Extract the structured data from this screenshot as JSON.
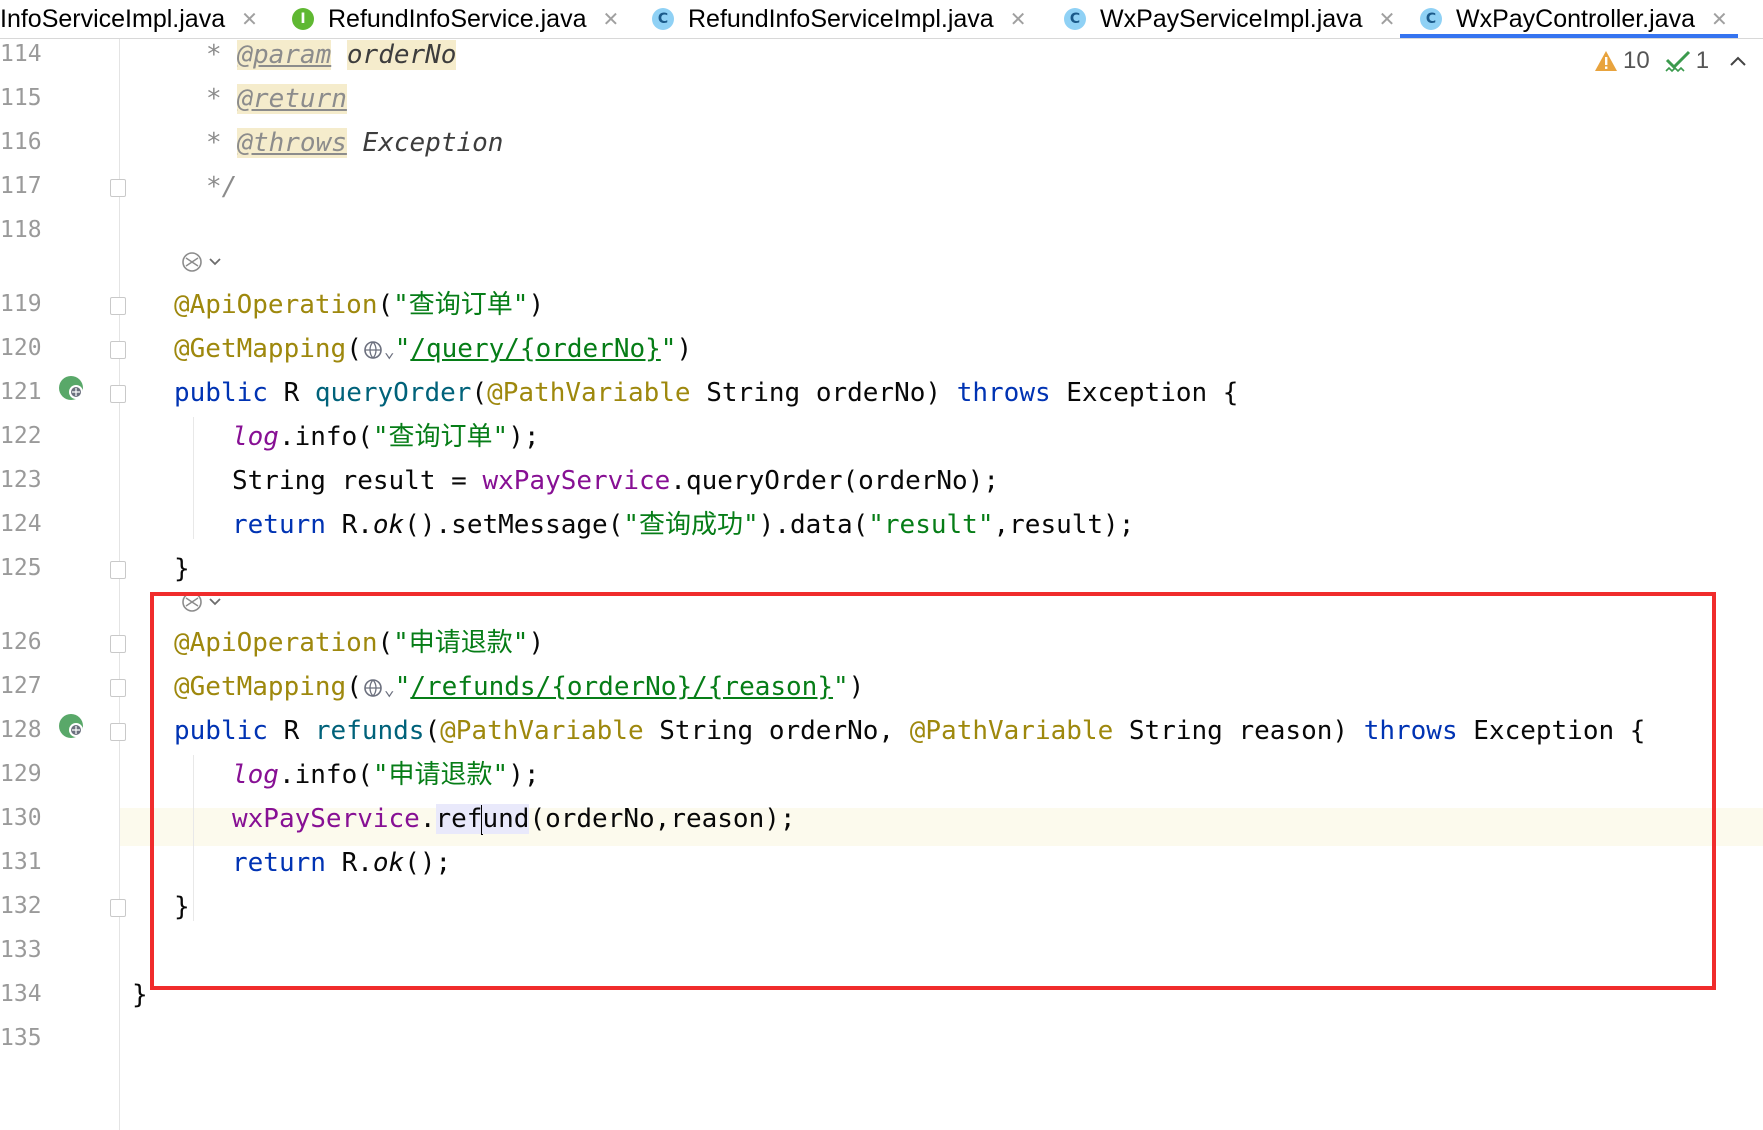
{
  "tabs": [
    {
      "label": "InfoServiceImpl.java",
      "icon": "",
      "active": false
    },
    {
      "label": "RefundInfoService.java",
      "icon": "I",
      "active": false
    },
    {
      "label": "RefundInfoServiceImpl.java",
      "icon": "C",
      "active": false
    },
    {
      "label": "WxPayServiceImpl.java",
      "icon": "C",
      "active": false
    },
    {
      "label": "WxPayController.java",
      "icon": "C",
      "active": true
    }
  ],
  "close_glyph": "✕",
  "inspections": {
    "warnings": "10",
    "checks": "1"
  },
  "line_numbers": [
    "114",
    "115",
    "116",
    "117",
    "118",
    "119",
    "120",
    "121",
    "122",
    "123",
    "124",
    "125",
    "126",
    "127",
    "128",
    "129",
    "130",
    "131",
    "132",
    "133",
    "134",
    "135"
  ],
  "code": {
    "l114": {
      "star": "*",
      "tag": "@param",
      "name": "orderNo"
    },
    "l115": {
      "star": "*",
      "tag": "@return"
    },
    "l116": {
      "star": "*",
      "tag": "@throws",
      "name": "Exception"
    },
    "l117": {
      "text": "*/"
    },
    "l119": {
      "anno": "@ApiOperation",
      "open": "(",
      "str": "\"查询订单\"",
      "close": ")"
    },
    "l120": {
      "anno": "@GetMapping",
      "open": "(",
      "chev": "⌄",
      "q1": "\"",
      "path": "/query/{orderNo}",
      "q2": "\"",
      "close": ")"
    },
    "l121": {
      "kw": "public",
      "sp1": " R ",
      "fn": "queryOrder",
      "open": "(",
      "anno": "@PathVariable",
      "rest": " String orderNo) ",
      "throws": "throws",
      "tail": " Exception {"
    },
    "l122": {
      "fld": "log",
      "mid": ".info(",
      "str": "\"查询订单\"",
      "tail": ");"
    },
    "l123": {
      "head": "String result = ",
      "fld": "wxPayService",
      "tail": ".queryOrder(orderNo);"
    },
    "l124": {
      "kw": "return",
      "mid1": " R.",
      "ok": "ok",
      "mid2": "().setMessage(",
      "str1": "\"查询成功\"",
      "mid3": ").data(",
      "str2": "\"result\"",
      "tail": ",result);"
    },
    "l125": {
      "text": "}"
    },
    "l126": {
      "anno": "@ApiOperation",
      "open": "(",
      "str": "\"申请退款\"",
      "close": ")"
    },
    "l127": {
      "anno": "@GetMapping",
      "open": "(",
      "chev": "⌄",
      "q1": "\"",
      "path": "/refunds/{orderNo}/{reason}",
      "q2": "\"",
      "close": ")"
    },
    "l128": {
      "kw": "public",
      "sp1": " R ",
      "fn": "refunds",
      "open": "(",
      "anno1": "@PathVariable",
      "mid": " String orderNo, ",
      "anno2": "@PathVariable",
      "rest": " String reason) ",
      "throws": "throws",
      "tail": " Exception {"
    },
    "l129": {
      "fld": "log",
      "mid": ".info(",
      "str": "\"申请退款\"",
      "tail": ");"
    },
    "l130": {
      "fld": "wxPayService",
      "dot": ".",
      "m1": "ref",
      "m2": "und",
      "tail": "(orderNo,reason);"
    },
    "l131": {
      "kw": "return",
      "mid": " R.",
      "ok": "ok",
      "tail": "();"
    },
    "l132": {
      "text": "}"
    },
    "l134": {
      "text": "}"
    }
  },
  "colors": {
    "highlight_box": "#f02c2c",
    "active_tab_underline": "#3574f0",
    "current_line": "#fcfaed"
  }
}
